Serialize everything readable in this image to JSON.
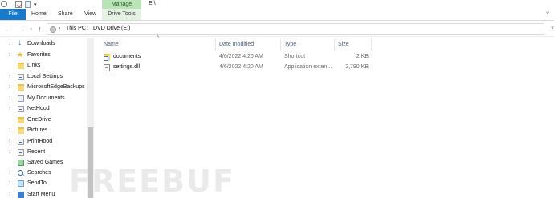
{
  "window": {
    "title": "E:\\"
  },
  "quick_access": {
    "dropdown": "▾"
  },
  "ribbon": {
    "contextual_group": "Manage",
    "tabs": [
      {
        "label": "File"
      },
      {
        "label": "Home"
      },
      {
        "label": "Share"
      },
      {
        "label": "View"
      },
      {
        "label": "Drive Tools"
      }
    ],
    "expand": "˅"
  },
  "nav": {
    "back": "←",
    "forward": "→",
    "recent": "˅",
    "up": "↑"
  },
  "address": {
    "separator": "›",
    "crumbs": [
      "This PC",
      "DVD Drive (E:)"
    ],
    "refresh": "˅"
  },
  "sidebar": {
    "chevron": "›",
    "items": [
      {
        "label": "Downloads",
        "icon": "download-icon"
      },
      {
        "label": "Favorites",
        "icon": "star-icon"
      },
      {
        "label": "Links",
        "icon": "folder-icon"
      },
      {
        "label": "Local Settings",
        "icon": "shortcut-folder-icon"
      },
      {
        "label": "MicrosoftEdgeBackups",
        "icon": "folder-icon"
      },
      {
        "label": "My Documents",
        "icon": "shortcut-folder-icon"
      },
      {
        "label": "NetHood",
        "icon": "shortcut-folder-icon"
      },
      {
        "label": "OneDrive",
        "icon": "folder-icon"
      },
      {
        "label": "Pictures",
        "icon": "folder-icon"
      },
      {
        "label": "PrintHood",
        "icon": "shortcut-folder-icon"
      },
      {
        "label": "Recent",
        "icon": "shortcut-folder-icon"
      },
      {
        "label": "Saved Games",
        "icon": "saved-games-icon"
      },
      {
        "label": "Searches",
        "icon": "search-icon"
      },
      {
        "label": "SendTo",
        "icon": "send-to-icon"
      },
      {
        "label": "Start Menu",
        "icon": "start-menu-icon"
      }
    ]
  },
  "columns": {
    "name": "Name",
    "date_modified": "Date modified",
    "type": "Type",
    "size": "Size",
    "sort_indicator": "˄"
  },
  "files": [
    {
      "name": "documents",
      "date_modified": "4/6/2022 4:20 AM",
      "type": "Shortcut",
      "size": "2 KB",
      "icon": "shortcut-icon"
    },
    {
      "name": "settings.dll",
      "date_modified": "4/6/2022 4:20 AM",
      "type": "Application exten...",
      "size": "2,790 KB",
      "icon": "dll-file-icon"
    }
  ],
  "watermark": "FREEBUF"
}
